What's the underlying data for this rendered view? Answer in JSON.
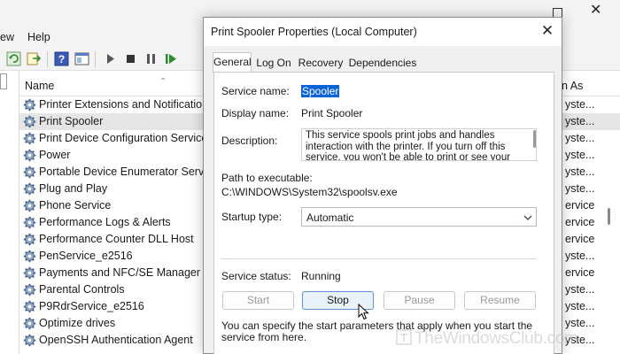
{
  "services_window": {
    "menu": {
      "view": "ew",
      "help": "Help"
    },
    "columns": {
      "name": "Name",
      "startup_as": "n As"
    },
    "services": [
      {
        "name": "Printer Extensions and Notifications",
        "logon": "yste..."
      },
      {
        "name": "Print Spooler",
        "logon": "yste...",
        "selected": true
      },
      {
        "name": "Print Device Configuration Service",
        "logon": "yste..."
      },
      {
        "name": "Power",
        "logon": "yste..."
      },
      {
        "name": "Portable Device Enumerator Service",
        "logon": "yste..."
      },
      {
        "name": "Plug and Play",
        "logon": "yste..."
      },
      {
        "name": "Phone Service",
        "logon": "ervice"
      },
      {
        "name": "Performance Logs & Alerts",
        "logon": "ervice"
      },
      {
        "name": "Performance Counter DLL Host",
        "logon": "ervice"
      },
      {
        "name": "PenService_e2516",
        "logon": "yste..."
      },
      {
        "name": "Payments and NFC/SE Manager",
        "logon": "ervice"
      },
      {
        "name": "Parental Controls",
        "logon": "yste..."
      },
      {
        "name": "P9RdrService_e2516",
        "logon": "yste..."
      },
      {
        "name": "Optimize drives",
        "logon": "yste..."
      },
      {
        "name": "OpenSSH Authentication Agent",
        "logon": "yste..."
      }
    ]
  },
  "dialog": {
    "title": "Print Spooler Properties (Local Computer)",
    "tabs": [
      "General",
      "Log On",
      "Recovery",
      "Dependencies"
    ],
    "active_tab": "General",
    "service_name_label": "Service name:",
    "service_name": "Spooler",
    "display_name_label": "Display name:",
    "display_name": "Print Spooler",
    "description_label": "Description:",
    "description": "This service spools print jobs and handles interaction with the printer.  If you turn off this service, you won't be able to print or see your printers.",
    "path_label": "Path to executable:",
    "path": "C:\\WINDOWS\\System32\\spoolsv.exe",
    "startup_type_label": "Startup type:",
    "startup_type": "Automatic",
    "status_label": "Service status:",
    "status": "Running",
    "buttons": {
      "start": "Start",
      "stop": "Stop",
      "pause": "Pause",
      "resume": "Resume"
    },
    "params_hint": "You can specify the start parameters that apply when you start the service from here."
  },
  "watermark": "TheWindowsClub.com",
  "colors": {
    "selection": "#0a64d8",
    "selected_row": "#e5e5e5",
    "accent_button": "#5c8ed9"
  }
}
